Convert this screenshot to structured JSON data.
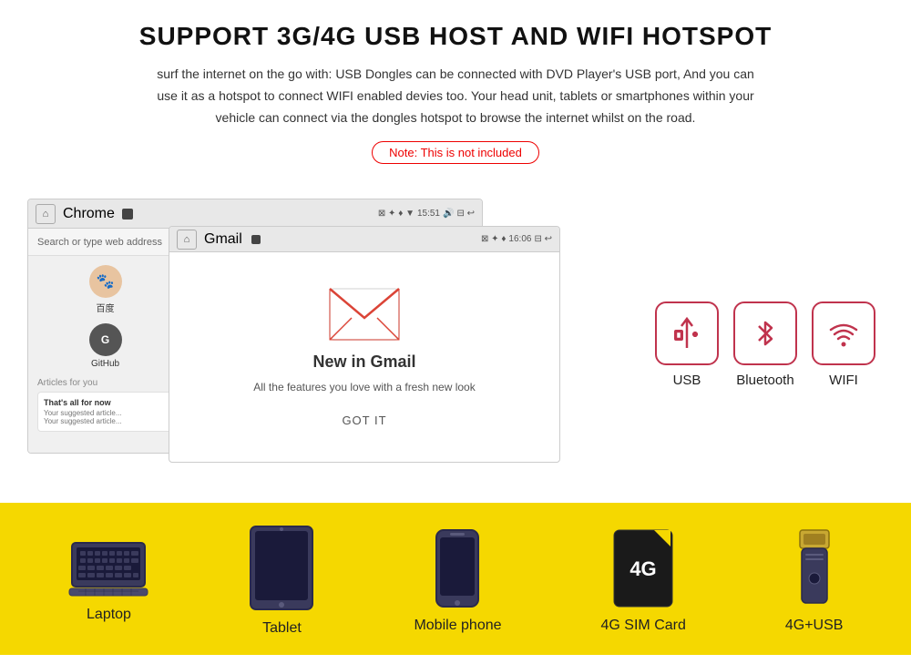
{
  "header": {
    "title": "SUPPORT 3G/4G USB HOST AND WIFI HOTSPOT",
    "description": "surf the internet on the go with: USB Dongles can be connected with DVD Player's USB port, And you can use it as a hotspot to connect WIFI enabled devies too. Your head unit, tablets or smartphones within your vehicle can connect via the dongles hotspot to browse the internet whilst on the road.",
    "note": "Note: This is not included"
  },
  "chrome_window": {
    "title": "Chrome",
    "time": "15:51",
    "search_placeholder": "Search or type web address"
  },
  "gmail_window": {
    "title": "Gmail",
    "time": "16:06",
    "new_title": "New in Gmail",
    "new_body": "All the features you love with a fresh new look",
    "got_it": "GOT IT",
    "baidu_label": "百度",
    "github_label": "GitHub",
    "articles_label": "Articles for you",
    "article1_title": "That's all for now",
    "article1_body": "Your suggested article..."
  },
  "feature_icons": [
    {
      "id": "usb",
      "label": "USB",
      "icon": "usb-icon"
    },
    {
      "id": "bluetooth",
      "label": "Bluetooth",
      "icon": "bluetooth-icon"
    },
    {
      "id": "wifi",
      "label": "WIFI",
      "icon": "wifi-icon"
    }
  ],
  "devices": [
    {
      "id": "laptop",
      "label": "Laptop"
    },
    {
      "id": "tablet",
      "label": "Tablet"
    },
    {
      "id": "mobile",
      "label": "Mobile phone"
    },
    {
      "id": "sim",
      "label": "4G SIM Card",
      "badge": "4G"
    },
    {
      "id": "usb-dongle",
      "label": "4G+USB"
    }
  ]
}
